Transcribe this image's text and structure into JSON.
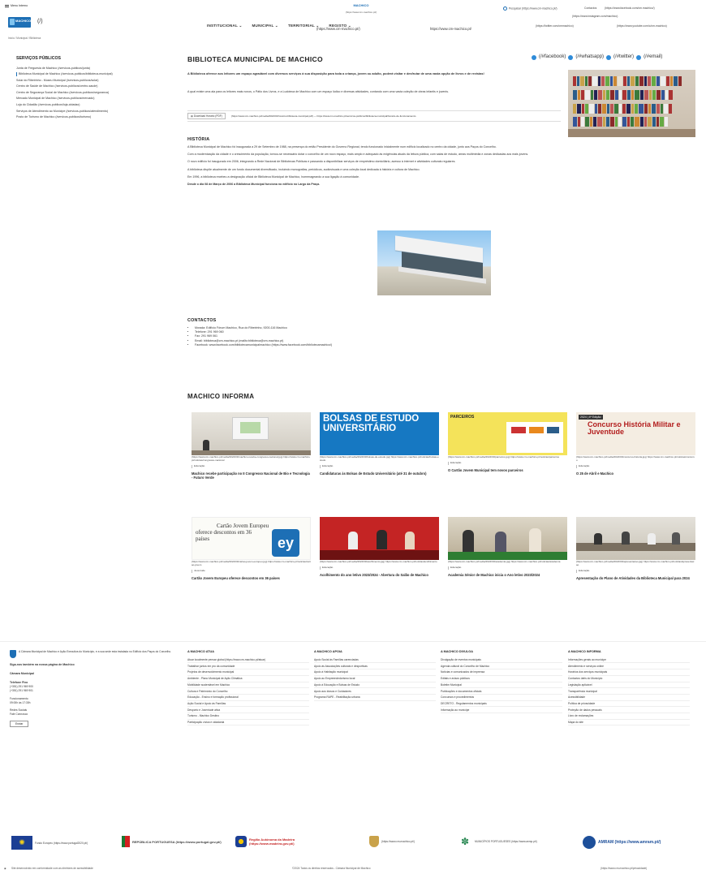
{
  "header": {
    "menu_label": "Menu Interno",
    "logo_text": "MACHICO",
    "logo_suffix": "(/)",
    "center_logo": "MACHICO",
    "center_url": "(https://www.cm-machico.pt/)",
    "nav": [
      "INSTITUCIONAL",
      "MUNICIPAL",
      "TERRITORIAL",
      "REGISTO"
    ],
    "site_url_left": "(https://www.cm-machico.pt/)",
    "site_url_right": "https://www.cm-machico.pt/",
    "search_label": "Pesquisar (https://www.cm-machico.pt/)",
    "util_links": [
      "Contactos",
      "(https://www.facebook.com/cm.machico/)",
      "(https://www.instagram.com/machico)",
      "(https://twitter.com/cmmachico)",
      "(https://www.youtube.com/c/cm-machico)"
    ]
  },
  "breadcrumb": "Início / Municipal / Biblioteca",
  "sidebar": {
    "title": "SERVIÇOS PÚBLICOS",
    "items": [
      "Junta de Freguesia de Machico (/servicos-publicos/junta)",
      "Biblioteca Municipal de Machico (/servicos-publicos/biblioteca-municipal)",
      "Solar do Ribeirinho - Museu Municipal (/servicos-publicos/solar)",
      "Centro de Saúde de Machico (/servicos-publicos/centro-saude)",
      "Centro de Segurança Social de Machico (/servicos-publicos/seguranca)",
      "Mercado Municipal de Machico (/servicos-publicos/mercado)",
      "Loja do Cidadão (/servicos-publicos/loja-cidadao)",
      "Serviços de Atendimento ao Munícipe (/servicos-publicos/atendimento)",
      "Posto de Turismo de Machico (/servicos-publicos/turismo)"
    ]
  },
  "article": {
    "title": "BIBLIOTECA MUNICIPAL DE MACHICO",
    "share_labels": [
      "(/#facebook)",
      "(/#whatsapp)",
      "(/#twitter)",
      "(/#email)"
    ],
    "lead": "A Biblioteca oferece aos leitores um espaço agradável com diversos serviços à sua disposição para toda a criança, jovem ou adulto, poderá visitar e desfrutar de uma vasta opção de livros e de revistas!",
    "intro": "A qual existe uma ala para os leitores mais novos, o Pátio dos Livros, e a Ludoteca de Machico com um espaço lúdico e diversas atividades, contando com uma vasta coleção de obras infantis e juvenis.",
    "file_meta": "Download Horário (PDF)",
    "file_url": "(https://www.cm-machico.pt/media/2024/01/horario-biblioteca-municipal.pdf) — https://www.cm-machico.pt/servicos-publicos/biblioteca-municipal/horario-de-funcionamento",
    "history_title": "HISTÓRIA",
    "history": [
      "A Biblioteca Municipal de Machico foi inaugurada a 29 de Setembro de 1988, na presença do então Presidente do Governo Regional, tendo funcionado inicialmente num edifício localizado no centro da cidade, junto aos Paços do Concelho.",
      "Com a modernização da cidade e o crescimento da população, tornou-se necessário dotar o concelho de um novo espaço, mais amplo e adequado às exigências atuais da leitura pública, com salas de estudo, áreas multimédia e zonas dedicadas aos mais jovens.",
      "O novo edifício foi inaugurado em 2006, integrando a Rede Nacional de Bibliotecas Públicas e passando a disponibilizar serviços de empréstimo domiciliário, acesso à internet e atividades culturais regulares.",
      "A biblioteca dispõe atualmente de um fundo documental diversificado, incluindo monografias, periódicos, audiovisuais e uma coleção local dedicada à história e cultura de Machico.",
      "Em 1996, a biblioteca recebeu a designação oficial de Biblioteca Municipal de Machico, homenageando a sua ligação à comunidade.",
      "Desde o dia 08 de Março de 2006 a Biblioteca Municipal funciona no edifício no Largo da Praça."
    ],
    "contacts_title": "CONTACTOS",
    "contacts": [
      "Morada: Edifício Fórum Machico, Rua do Ribeirinho, 9200-116 Machico",
      "Telefone: 291 969 060",
      "Fax: 291 969 061",
      "Email: biblioteca@cm-machico.pt (mailto:biblioteca@cm-machico.pt)",
      "Facebook: www.facebook.com/bibliotecamunicipalmachico (https://www.facebook.com/bibliotecamachico/)"
    ]
  },
  "news": {
    "title": "MACHICO INFORMA",
    "cards": [
      {
        "url": "(https://www.cm-machico.pt/media/2024/03/machico-recebe-congresso-nacional.jpg) https://www.cm-machico.pt/noticias/congresso-nacional",
        "cat": "Educação",
        "title": "Machico recebe participação no II Congresso Nacional de Bio e Tecnologia - Futuro Verde"
      },
      {
        "url": "(https://www.cm-machico.pt/media/2024/03/bolsas-de-estudo.jpg) https://www.cm-machico.pt/noticias/bolsas-estudo",
        "cat": "Educação",
        "title": "Candidaturas às Bolsas de Estudo Universitário (até 31 de outubro)",
        "thumb_title": "BOLSAS DE ESTUDO UNIVERSITÁRIO"
      },
      {
        "url": "(https://www.cm-machico.pt/media/2024/03/parceiros.jpg) https://www.cm-machico.pt/noticias/parceiros",
        "cat": "Educação",
        "title": "O Cartão Jovem Municipal tem novos parceiros",
        "thumb_title": "PARCEIROS"
      },
      {
        "url": "(https://www.cm-machico.pt/media/2024/03/concurso-historia.jpg) https://www.cm-machico.pt/noticias/concurso",
        "cat": "Educação",
        "title": "O 25 de Abril e Machico",
        "thumb_title": "Concurso História Militar e Juventude",
        "thumb_tag": "2024 | 4ª Edição"
      },
      {
        "url": "(https://www.cm-machico.pt/media/2024/03/cartao-jovem-europeu.jpg) https://www.cm-machico.pt/noticias/cartao-jovem",
        "cat": "Juventude",
        "title": "Cartão Jovem Europeu oferece descontos em 36 países",
        "thumb_title": "Cartão Jovem Europeu",
        "thumb_sub": "oferece descontos em 36 países"
      },
      {
        "url": "(https://www.cm-machico.pt/media/2024/03/acolhimento.jpg) https://www.cm-machico.pt/noticias/acolhimento",
        "cat": "Educação",
        "title": "Acolhimento do ano letivo 2023/2024 - Abertura do Salão de Machico"
      },
      {
        "url": "(https://www.cm-machico.pt/media/2024/03/academia.jpg) https://www.cm-machico.pt/noticias/academia",
        "cat": "Educação",
        "title": "Academia Sénior de Machico inicia o Ano letivo 2023/2024"
      },
      {
        "url": "(https://www.cm-machico.pt/media/2024/03/apresentacao.jpg) https://www.cm-machico.pt/noticias/apresentacao",
        "cat": "Educação",
        "title": "Apresentação do Plano de Atividades da Biblioteca Municipal para 2024"
      }
    ]
  },
  "footer": {
    "intro": "A Câmara Municipal de Machico e Ação Executiva do Município, e a sua sede esta instalada no Edifício dos Paços do Concelho.",
    "address_title": "Siga-nos também na nossa página de Machico",
    "rows": [
      "Câmara Municipal",
      "Telefone Fixo",
      "(+351) 291 969 900",
      "(+351) 291 969 901",
      "Funcionamento",
      "09:00h às 17:30h",
      "Redes Sociais",
      "Fale Connosco"
    ],
    "button": "Enviar",
    "cols": [
      {
        "title": "A MACHICO ATUA",
        "items": [
          "Atuar localmente pensar global (https://www.cm-machico.pt/atuar)",
          "Trabalhar juntos em pro da comunidade",
          "Projetos de desenvolvimento municipal",
          "Ambiente - Plano Municipal de Ação Climática",
          "Mobilidade sustentável em Machico",
          "Cultura e Património do Concelho",
          "Educação - Ensino e formação profissional",
          "Ação Social e Apoio às Famílias",
          "Desporto e Juventude ativa",
          "Turismo - Machico Destino",
          "Participação cívica e cidadania"
        ]
      },
      {
        "title": "A MACHICO APOIA",
        "items": [
          "Apoio Social às Famílias carenciadas",
          "Apoio às Associações culturais e desportivas",
          "Apoio à Habitação municipal",
          "Apoio ao Empreendedorismo local",
          "Apoio à Educação e Bolsas de Estudo",
          "Apoio aos Idosos e Cuidadores",
          "Programa RAPE - Reabilitação urbana"
        ]
      },
      {
        "title": "A MACHICO DIVULGA",
        "items": [
          "Divulgação de eventos municipais",
          "Agenda cultural do Concelho de Machico",
          "Notícias e comunicados de imprensa",
          "Editais e avisos públicos",
          "Boletim Municipal",
          "Publicações e documentos oficiais",
          "Concursos e procedimentos",
          "DECRETO - Regulamentos municipais",
          "Informação ao munícipe"
        ]
      },
      {
        "title": "A MACHICO INFORMA",
        "items": [
          "Informações gerais ao munícipe",
          "Atendimento e serviços online",
          "Horários dos serviços municipais",
          "Contactos úteis do Município",
          "Legislação aplicável",
          "Transparência municipal",
          "Acessibilidade",
          "Política de privacidade",
          "Proteção de dados pessoais",
          "Livro de reclamações",
          "Mapa do site"
        ]
      }
    ]
  },
  "partners": [
    {
      "label": "Fundo Europeu (https://www.portugal2020.pt/)"
    },
    {
      "label": "REPÚBLICA PORTUGUESA (https://www.portugal.gov.pt/)"
    },
    {
      "label": "Região Autónoma da Madeira (https://www.madeira.gov.pt/)"
    },
    {
      "label": "(https://www.cm-machico.pt/)"
    },
    {
      "label": "MUNICÍPIOS PORTUGUESES (https://www.anmp.pt/)"
    },
    {
      "label": "AMRAM (https://www.amram.pt/)"
    }
  ],
  "bottom": {
    "left": "Site desenvolvido em conformidade com as diretrizes de acessibilidade",
    "center": "©2024 Todos os direitos reservados - Câmara Municipal de Machico",
    "right": "(https://www.cm-machico.pt/privacidade)"
  }
}
